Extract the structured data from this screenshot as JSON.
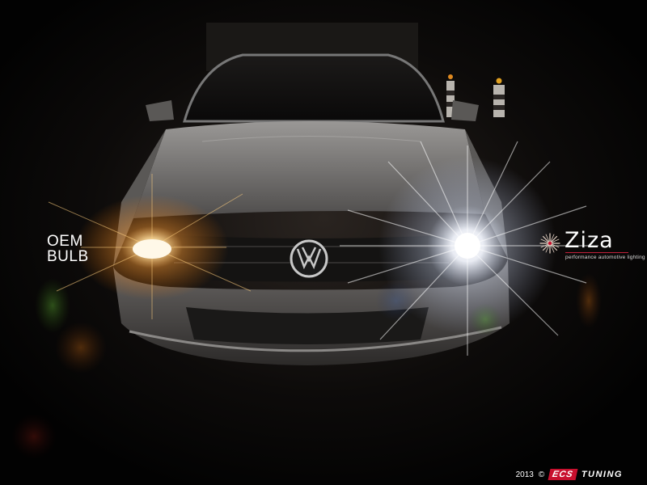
{
  "overlay": {
    "left_label_line1": "OEM",
    "left_label_line2": "BULB",
    "brand_name": "Ziza",
    "brand_tagline": "performance automotive lighting"
  },
  "footer": {
    "year": "2013",
    "copyright_symbol": "©",
    "company_box": "ECS",
    "company_suffix": "TUNING"
  },
  "colors": {
    "background": "#000000",
    "oem_glow": "#ffb347",
    "led_glow": "#eef4ff",
    "brand_accent": "#c8102e"
  }
}
